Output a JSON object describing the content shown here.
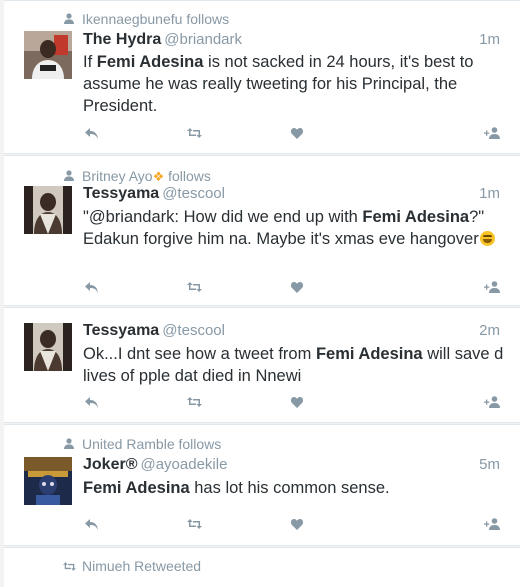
{
  "tweets": [
    {
      "context_type": "follows",
      "context_user": "Ikennaegbunefu",
      "context_label": "follows",
      "name": "The Hydra",
      "handle": "@briandark",
      "time": "1m",
      "text_parts": [
        {
          "t": "If ",
          "b": false
        },
        {
          "t": "Femi Adesina",
          "b": true
        },
        {
          "t": " is not sacked in 24 hours, it's best to assume he was really tweeting for his Principal, the President.",
          "b": false
        }
      ]
    },
    {
      "context_type": "follows",
      "context_user": "Britney Ayo",
      "context_label": "follows",
      "name": "Tessyama",
      "handle": "@tescool",
      "time": "1m",
      "text_parts": [
        {
          "t": "\"@briandark: How did we end up with ",
          "b": false
        },
        {
          "t": "Femi Adesina",
          "b": true
        },
        {
          "t": "?\" Edakun forgive him na. Maybe it's xmas eve hangover",
          "b": false
        }
      ]
    },
    {
      "context_type": "none",
      "name": "Tessyama",
      "handle": "@tescool",
      "time": "2m",
      "text_parts": [
        {
          "t": "Ok...I dnt see how a tweet from ",
          "b": false
        },
        {
          "t": "Femi Adesina",
          "b": true
        },
        {
          "t": " will save d lives of pple dat died in Nnewi",
          "b": false
        }
      ]
    },
    {
      "context_type": "follows",
      "context_user": "United Ramble",
      "context_label": "follows",
      "name": "Joker®",
      "handle": "@ayoadekile",
      "time": "5m",
      "text_parts": [
        {
          "t": "Femi Adesina",
          "b": true
        },
        {
          "t": " has lot his common sense.",
          "b": false
        }
      ]
    },
    {
      "context_type": "retweet",
      "context_user": "Nimueh",
      "context_label": "Retweeted"
    }
  ],
  "colors": {
    "text": "#292f33",
    "muted": "#8899a6",
    "background": "#f3f3f3",
    "card": "#ffffff",
    "divider": "#e1e8ed"
  },
  "icons": {
    "follow_context": "person-icon",
    "retweet_context": "retweet-icon",
    "reply": "reply-icon",
    "retweet": "retweet-icon",
    "like": "heart-icon",
    "follow": "follow-icon"
  }
}
